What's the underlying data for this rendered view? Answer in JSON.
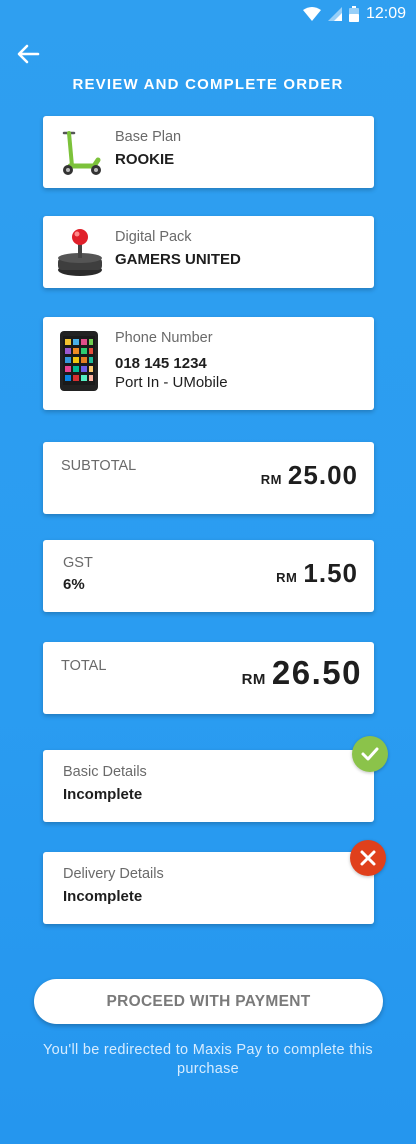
{
  "status_bar": {
    "time": "12:09",
    "icons": [
      "wifi-icon",
      "signal-icon",
      "battery-icon"
    ]
  },
  "header": {
    "title": "REVIEW AND COMPLETE ORDER",
    "back_icon": "arrow-left-icon"
  },
  "plan": {
    "label": "Base Plan",
    "value": "ROOKIE",
    "icon": "scooter-icon"
  },
  "digital_pack": {
    "label": "Digital Pack",
    "value": "GAMERS UNITED",
    "icon": "joystick-icon"
  },
  "phone": {
    "label": "Phone Number",
    "number": "018 145 1234",
    "port": "Port In - UMobile",
    "icon": "smartphone-icon"
  },
  "subtotal": {
    "label": "SUBTOTAL",
    "currency": "RM",
    "amount": "25.00"
  },
  "gst": {
    "label": "GST",
    "rate": "6%",
    "currency": "RM",
    "amount": "1.50"
  },
  "total": {
    "label": "TOTAL",
    "currency": "RM",
    "amount": "26.50"
  },
  "basic_details": {
    "label": "Basic Details",
    "status": "Incomplete",
    "badge": "check-icon",
    "badge_color": "#8bc34a"
  },
  "delivery_details": {
    "label": "Delivery Details",
    "status": "Incomplete",
    "badge": "close-icon",
    "badge_color": "#e0401c"
  },
  "action": {
    "button_label": "PROCEED WITH PAYMENT",
    "note": "You'll be redirected to Maxis Pay to complete this purchase"
  },
  "colors": {
    "background": "#2a9cf1",
    "card": "#ffffff"
  }
}
